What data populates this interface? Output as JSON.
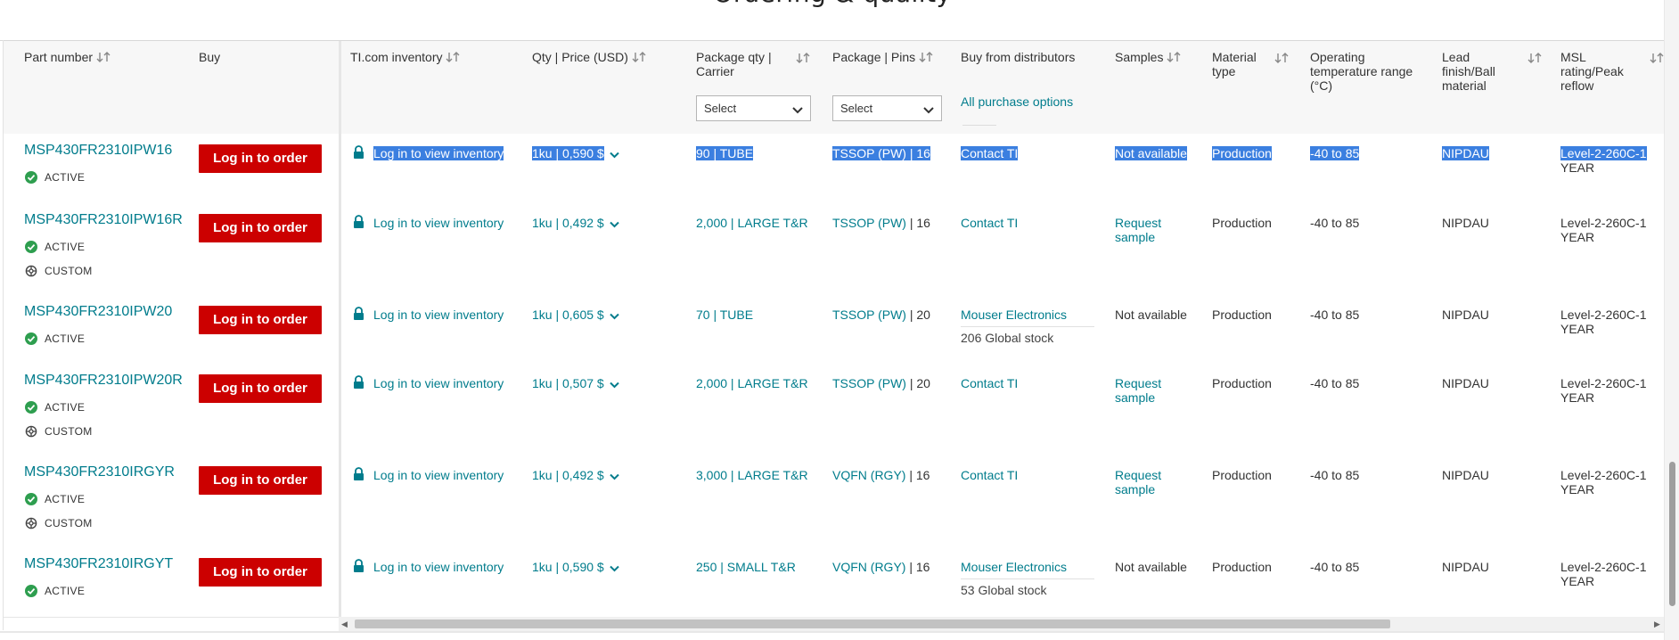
{
  "section_title": "Ordering & quality",
  "columns": {
    "part_number": "Part number",
    "buy": "Buy",
    "inventory": "TI.com inventory",
    "qty_price": "Qty | Price (USD)",
    "package_qty_line1": "Package qty |",
    "package_qty_line2": "Carrier",
    "package_pins": "Package | Pins",
    "distributors": "Buy from distributors",
    "samples": "Samples",
    "material_line1": "Material",
    "material_line2": "type",
    "temp_line1": "Operating",
    "temp_line2": "temperature range",
    "temp_line3": "(°C)",
    "lead_line1": "Lead",
    "lead_line2": "finish/Ball",
    "lead_line3": "material",
    "msl_line1": "MSL",
    "msl_line2": "rating/Peak",
    "msl_line3": "reflow"
  },
  "filters": {
    "package_qty_select": "Select",
    "package_pins_select": "Select",
    "purchase_options_link": "All purchase options"
  },
  "common": {
    "login_button": "Log in to order",
    "inventory_link": "Log in to view inventory",
    "status_active": "ACTIVE",
    "status_custom": "CUSTOM"
  },
  "rows": [
    {
      "part": "MSP430FR2310IPW16",
      "price": "1ku | 0,590 $",
      "pkg_qty": "90 | TUBE",
      "pkg_name": "TSSOP (PW)",
      "pins": "| 16",
      "distributor": "Contact TI",
      "stock": "",
      "samples_1": "Not available",
      "samples_2": "",
      "material": "Production",
      "temp": "-40 to 85",
      "lead": "NIPDAU",
      "msl_1": "Level-2-260C-1",
      "msl_2": "YEAR",
      "custom": false,
      "selected": true
    },
    {
      "part": "MSP430FR2310IPW16R",
      "price": "1ku | 0,492 $",
      "pkg_qty": "2,000 | LARGE T&R",
      "pkg_name": "TSSOP (PW)",
      "pins": "| 16",
      "distributor": "Contact TI",
      "stock": "",
      "samples_1": "Request",
      "samples_2": "sample",
      "material": "Production",
      "temp": "-40 to 85",
      "lead": "NIPDAU",
      "msl_1": "Level-2-260C-1",
      "msl_2": "YEAR",
      "custom": true,
      "selected": false
    },
    {
      "part": "MSP430FR2310IPW20",
      "price": "1ku | 0,605 $",
      "pkg_qty": "70 | TUBE",
      "pkg_name": "TSSOP (PW)",
      "pins": "| 20",
      "distributor": "Mouser Electronics",
      "stock": "206 Global stock",
      "samples_1": "Not available",
      "samples_2": "",
      "material": "Production",
      "temp": "-40 to 85",
      "lead": "NIPDAU",
      "msl_1": "Level-2-260C-1",
      "msl_2": "YEAR",
      "custom": false,
      "selected": false
    },
    {
      "part": "MSP430FR2310IPW20R",
      "price": "1ku | 0,507 $",
      "pkg_qty": "2,000 | LARGE T&R",
      "pkg_name": "TSSOP (PW)",
      "pins": "| 20",
      "distributor": "Contact TI",
      "stock": "",
      "samples_1": "Request",
      "samples_2": "sample",
      "material": "Production",
      "temp": "-40 to 85",
      "lead": "NIPDAU",
      "msl_1": "Level-2-260C-1",
      "msl_2": "YEAR",
      "custom": true,
      "selected": false
    },
    {
      "part": "MSP430FR2310IRGYR",
      "price": "1ku | 0,492 $",
      "pkg_qty": "3,000 | LARGE T&R",
      "pkg_name": "VQFN (RGY)",
      "pins": "| 16",
      "distributor": "Contact TI",
      "stock": "",
      "samples_1": "Request",
      "samples_2": "sample",
      "material": "Production",
      "temp": "-40 to 85",
      "lead": "NIPDAU",
      "msl_1": "Level-2-260C-1",
      "msl_2": "YEAR",
      "custom": true,
      "selected": false
    },
    {
      "part": "MSP430FR2310IRGYT",
      "price": "1ku | 0,590 $",
      "pkg_qty": "250 | SMALL T&R",
      "pkg_name": "VQFN (RGY)",
      "pins": "| 16",
      "distributor": "Mouser Electronics",
      "stock": "53 Global stock",
      "samples_1": "Not available",
      "samples_2": "",
      "material": "Production",
      "temp": "-40 to 85",
      "lead": "NIPDAU",
      "msl_1": "Level-2-260C-1",
      "msl_2": "YEAR",
      "custom": false,
      "selected": false
    }
  ],
  "colors": {
    "accent_teal": "#007c8c",
    "button_red": "#cc0000",
    "status_green": "#2e9e4f",
    "selection_blue": "#3b7fe0"
  },
  "icons": {
    "sort": "sort-arrows-icon",
    "lock": "lock-icon",
    "active": "check-circle-icon",
    "custom": "gear-icon",
    "chevron": "chevron-down-icon"
  }
}
